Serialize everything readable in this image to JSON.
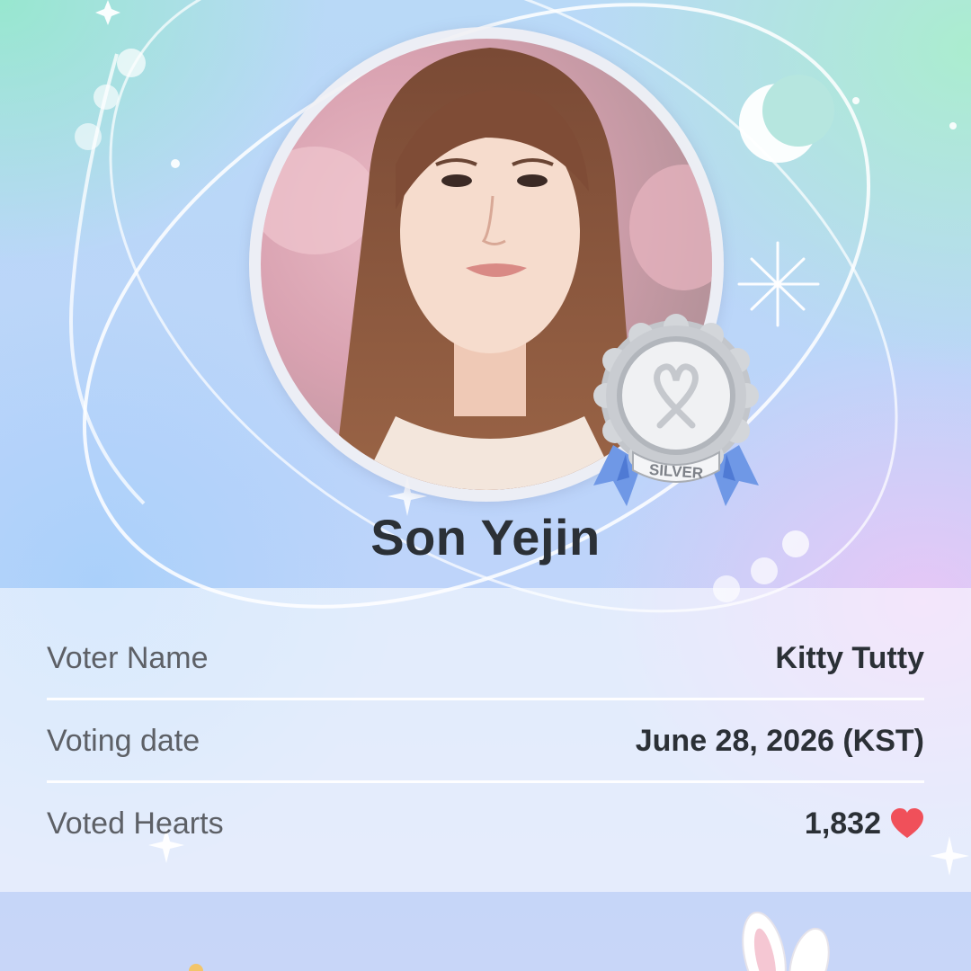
{
  "artist": {
    "name": "Son Yejin",
    "avatar": "portrait-photo",
    "tier_badge": {
      "label": "SILVER",
      "icon": "heart-ribbon-icon",
      "colors": {
        "medal": "#c9ccd1",
        "ribbon": "#6f98e6"
      }
    }
  },
  "details": [
    {
      "label": "Voter Name",
      "value": "Kitty Tutty"
    },
    {
      "label": "Voting date",
      "value": "June 28, 2026 (KST)"
    },
    {
      "label": "Voted Hearts",
      "value": "1,832",
      "icon": "heart-icon"
    }
  ],
  "colors": {
    "heart": "#f0505a",
    "text_primary": "#2b3036",
    "text_secondary": "#5d6066"
  }
}
